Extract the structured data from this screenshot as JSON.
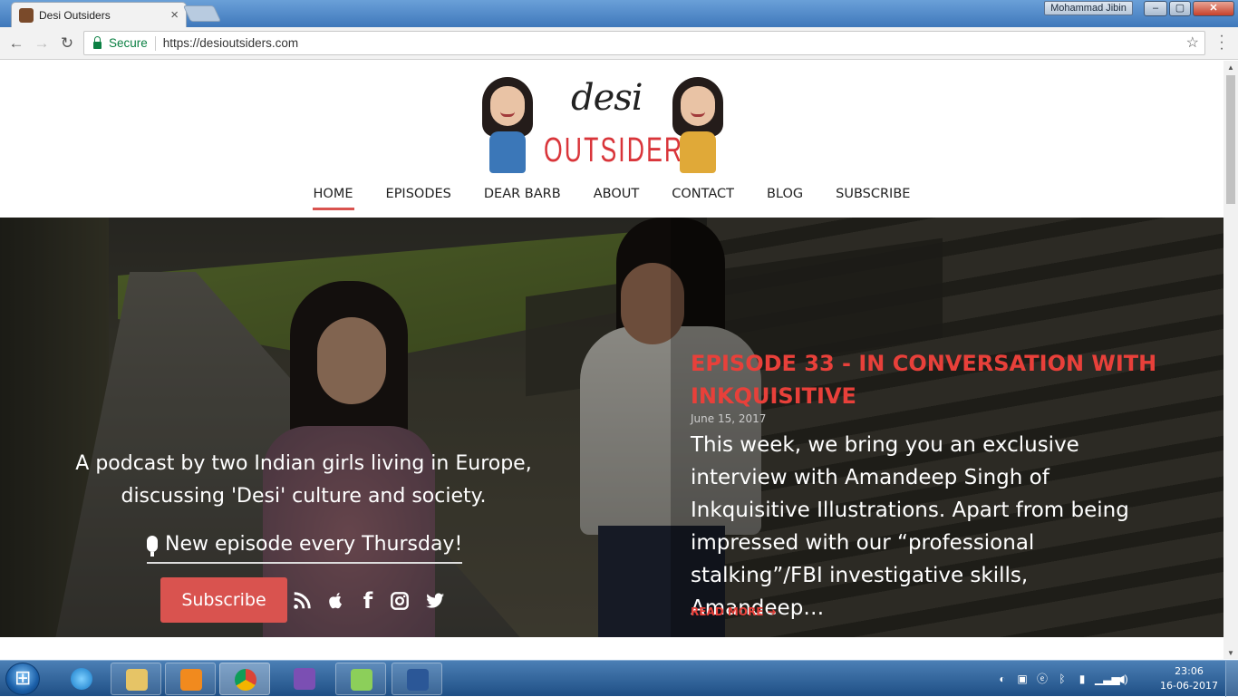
{
  "browser": {
    "tab_title": "Desi Outsiders",
    "user_badge": "Mohammad Jibin",
    "secure_label": "Secure",
    "url": "https://desioutsiders.com"
  },
  "site": {
    "logo_top": "desi",
    "logo_bottom": "OUTSIDERS",
    "nav": [
      {
        "label": "HOME",
        "active": true
      },
      {
        "label": "EPISODES"
      },
      {
        "label": "DEAR BARB"
      },
      {
        "label": "ABOUT"
      },
      {
        "label": "CONTACT"
      },
      {
        "label": "BLOG"
      },
      {
        "label": "SUBSCRIBE"
      }
    ],
    "accent": "#d9534f"
  },
  "hero": {
    "tagline": "A podcast by two Indian girls living in Europe, discussing 'Desi' culture and society.",
    "new_episode": "New episode every Thursday!",
    "subscribe_label": "Subscribe",
    "social_icons": [
      "rss-icon",
      "apple-icon",
      "facebook-icon",
      "instagram-icon",
      "twitter-icon"
    ],
    "facebook_glyph": "f"
  },
  "episode": {
    "title": "EPISODE 33 - IN CONVERSATION WITH INKQUISITIVE",
    "date": "June 15, 2017",
    "excerpt": "This week, we bring you an exclusive interview with Amandeep Singh of Inkquisitive Illustrations. Apart from being impressed with our “professional stalking”/FBI investigative skills, Amandeep…",
    "read_more": "READ MORE ➔"
  },
  "taskbar": {
    "time": "23:06",
    "date": "16-06-2017",
    "apps": [
      "explorer-icon",
      "ie-icon",
      "file-manager-icon",
      "media-player-icon",
      "chrome-icon",
      "visual-studio-icon",
      "notepad-plus-icon",
      "word-icon"
    ]
  }
}
